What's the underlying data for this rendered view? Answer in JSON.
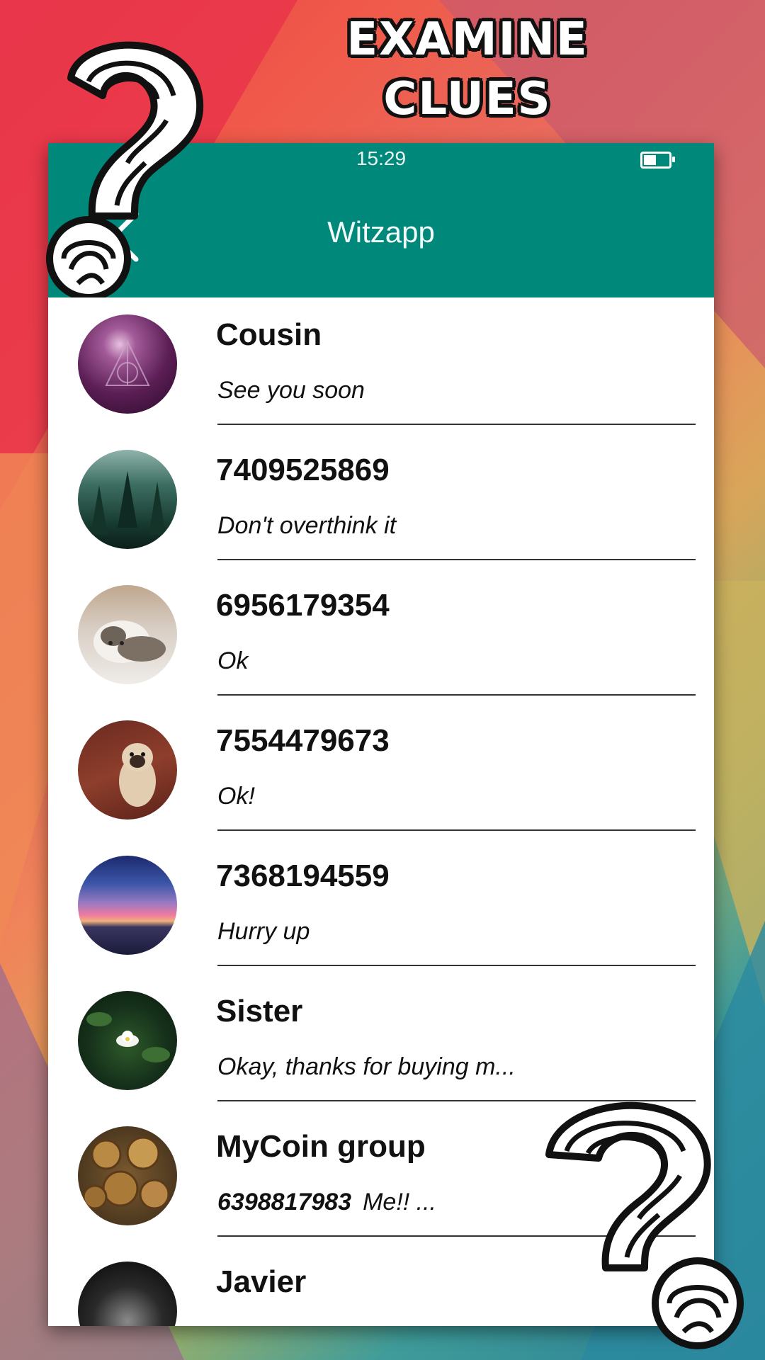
{
  "promo": {
    "headline_line1": "EXAMINE",
    "headline_line2": "CLUES"
  },
  "statusbar": {
    "time": "15:29",
    "battery_icon": "battery-icon"
  },
  "appbar": {
    "title": "Witzapp",
    "back_icon": "chevron-left-icon"
  },
  "colors": {
    "primary": "#00897b",
    "text": "#111111",
    "divider": "#333333"
  },
  "chats": [
    {
      "name": "Cousin",
      "preview": "See you soon",
      "sender": ""
    },
    {
      "name": "7409525869",
      "preview": "Don't overthink it",
      "sender": ""
    },
    {
      "name": "6956179354",
      "preview": "Ok",
      "sender": ""
    },
    {
      "name": "7554479673",
      "preview": "Ok!",
      "sender": ""
    },
    {
      "name": "7368194559",
      "preview": "Hurry up",
      "sender": ""
    },
    {
      "name": "Sister",
      "preview": "Okay, thanks for buying m...",
      "sender": ""
    },
    {
      "name": "MyCoin group",
      "preview": "Me!! ...",
      "sender": "6398817983"
    },
    {
      "name": "Javier",
      "preview": "",
      "sender": ""
    }
  ]
}
